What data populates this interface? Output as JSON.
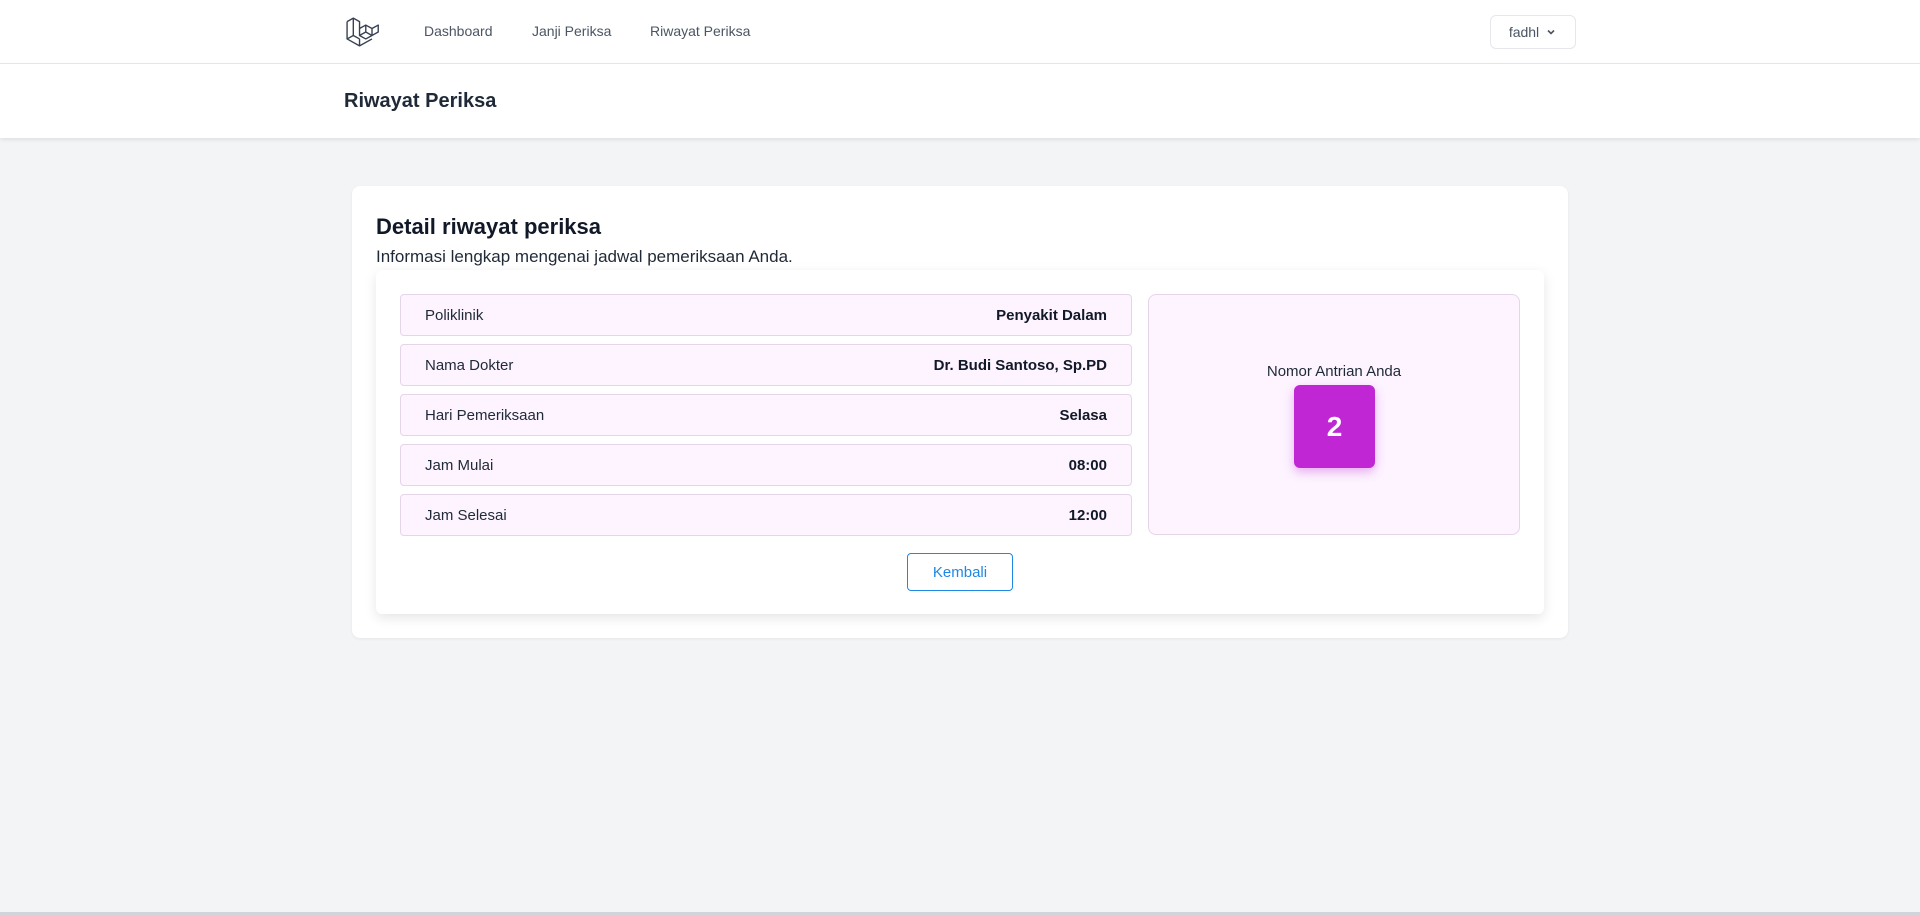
{
  "nav": {
    "links": [
      "Dashboard",
      "Janji Periksa",
      "Riwayat Periksa"
    ],
    "user": "fadhl"
  },
  "header": {
    "title": "Riwayat Periksa"
  },
  "card": {
    "title": "Detail riwayat periksa",
    "subtitle": "Informasi lengkap mengenai jadwal pemeriksaan Anda.",
    "rows": [
      {
        "label": "Poliklinik",
        "value": "Penyakit Dalam"
      },
      {
        "label": "Nama Dokter",
        "value": "Dr. Budi Santoso, Sp.PD"
      },
      {
        "label": "Hari Pemeriksaan",
        "value": "Selasa"
      },
      {
        "label": "Jam Mulai",
        "value": "08:00"
      },
      {
        "label": "Jam Selesai",
        "value": "12:00"
      }
    ],
    "queue": {
      "label": "Nomor Antrian Anda",
      "number": "2"
    },
    "back_label": "Kembali"
  },
  "colors": {
    "accent": "#c026d3",
    "row_bg": "#fdf4ff",
    "button": "#1e88e5"
  }
}
